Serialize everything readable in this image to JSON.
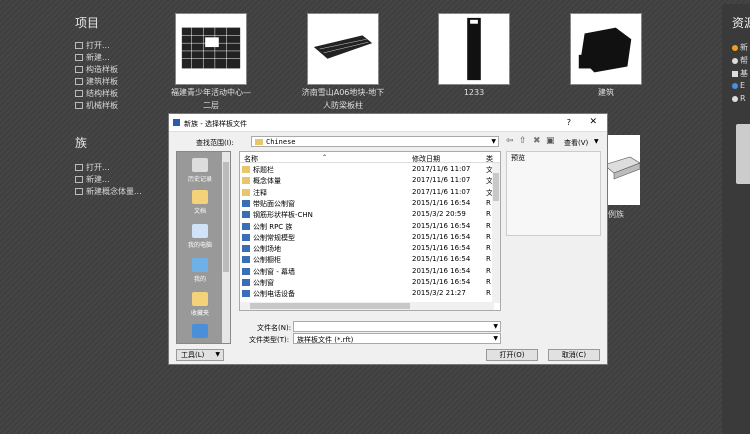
{
  "projects": {
    "title": "项目",
    "links": [
      "打开...",
      "新建...",
      "构造样板",
      "建筑样板",
      "结构样板",
      "机械样板"
    ],
    "thumbs": [
      {
        "label_line1": "福建青少年活动中心—",
        "label_line2": "二层"
      },
      {
        "label_line1": "济南雪山A06地块-地下",
        "label_line2": "人防梁板柱"
      },
      {
        "label_line1": "1233",
        "label_line2": ""
      },
      {
        "label_line1": "建筑",
        "label_line2": ""
      }
    ]
  },
  "families": {
    "title": "族",
    "links": [
      "打开...",
      "新建...",
      "新建概念体量..."
    ]
  },
  "resources": {
    "title": "资源",
    "items": [
      "新",
      "帮",
      "基",
      "E",
      "R"
    ],
    "colors": [
      "#f0a020",
      "#dddddd",
      "#dddddd",
      "#4a90e2",
      "#dddddd"
    ]
  },
  "bg_family_label": "样例族",
  "dialog": {
    "title": "新族 - 选择样板文件",
    "help": "?",
    "close": "✕",
    "lookin_label": "查找范围(I):",
    "lookin_value": "Chinese",
    "view_label": "查看(V)",
    "places": [
      "历史记录",
      "文档",
      "我的电脑",
      "我的",
      "收藏夹"
    ],
    "columns": {
      "name": "名称",
      "date": "修改日期",
      "type": "类"
    },
    "rows": [
      {
        "name": "标题栏",
        "date": "2017/11/6 11:07",
        "type": "文",
        "kind": "folder"
      },
      {
        "name": "概念体量",
        "date": "2017/11/6 11:07",
        "type": "文",
        "kind": "folder"
      },
      {
        "name": "注释",
        "date": "2017/11/6 11:07",
        "type": "文",
        "kind": "folder"
      },
      {
        "name": "带贴面公制窗",
        "date": "2015/1/16 16:54",
        "type": "R",
        "kind": "file"
      },
      {
        "name": "钢筋形状样板-CHN",
        "date": "2015/3/2 20:59",
        "type": "R",
        "kind": "file"
      },
      {
        "name": "公制 RPC 族",
        "date": "2015/1/16 16:54",
        "type": "R",
        "kind": "file"
      },
      {
        "name": "公制常规模型",
        "date": "2015/1/16 16:54",
        "type": "R",
        "kind": "file"
      },
      {
        "name": "公制场地",
        "date": "2015/1/16 16:54",
        "type": "R",
        "kind": "file"
      },
      {
        "name": "公制橱柜",
        "date": "2015/1/16 16:54",
        "type": "R",
        "kind": "file"
      },
      {
        "name": "公制窗 - 幕墙",
        "date": "2015/1/16 16:54",
        "type": "R",
        "kind": "file"
      },
      {
        "name": "公制窗",
        "date": "2015/1/16 16:54",
        "type": "R",
        "kind": "file"
      },
      {
        "name": "公制电话设备",
        "date": "2015/3/2 21:27",
        "type": "R",
        "kind": "file"
      }
    ],
    "preview_label": "预览",
    "filename_label": "文件名(N):",
    "filename_value": "",
    "filetype_label": "文件类型(T):",
    "filetype_value": "族样板文件 (*.rft)",
    "tools_label": "工具(L)",
    "open_label": "打开(O)",
    "cancel_label": "取消(C)"
  }
}
